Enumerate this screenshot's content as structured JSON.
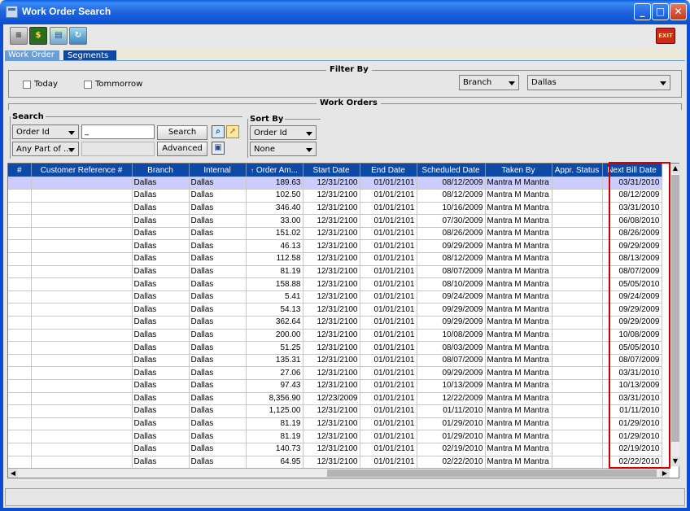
{
  "window": {
    "title": "Work Order Search",
    "buttons": {
      "minimize": "_",
      "maximize": "□",
      "close": "✕"
    }
  },
  "toolbar": {
    "icons": [
      "scanner-icon",
      "pay-icon",
      "report-icon",
      "refresh-icon"
    ],
    "pay_label": "$",
    "exit_label": "EXIT"
  },
  "tabs": [
    {
      "label": "Work Order",
      "active": false
    },
    {
      "label": "Segments",
      "active": true
    }
  ],
  "filter": {
    "legend": "Filter By",
    "today_label": "Today",
    "tomorrow_label": "Tommorrow",
    "field_value": "Branch",
    "city_value": "Dallas"
  },
  "orders": {
    "legend": "Work Orders"
  },
  "search": {
    "legend": "Search",
    "field_value": "Order Id",
    "match_value": "Any Part of ...",
    "input_value": "_",
    "search_button": "Search",
    "advanced_button": "Advanced"
  },
  "sort": {
    "legend": "Sort By",
    "primary_value": "Order Id",
    "secondary_value": "None"
  },
  "table": {
    "columns": [
      "#",
      "Customer Reference #",
      "Branch",
      "Internal",
      "Order Am...",
      "Start Date",
      "End Date",
      "Scheduled Date",
      "Taken By",
      "Appr. Status",
      "Next Bill Date"
    ],
    "sorted_column_marker": "↑",
    "rows": [
      [
        "",
        "",
        "Dallas",
        "Dallas",
        "189.63",
        "12/31/2100",
        "01/01/2101",
        "08/12/2009",
        "Mantra M Mantra",
        "",
        "03/31/2010"
      ],
      [
        "",
        "",
        "Dallas",
        "Dallas",
        "102.50",
        "12/31/2100",
        "01/01/2101",
        "08/12/2009",
        "Mantra M Mantra",
        "",
        "08/12/2009"
      ],
      [
        "",
        "",
        "Dallas",
        "Dallas",
        "346.40",
        "12/31/2100",
        "01/01/2101",
        "10/16/2009",
        "Mantra M Mantra",
        "",
        "03/31/2010"
      ],
      [
        "",
        "",
        "Dallas",
        "Dallas",
        "33.00",
        "12/31/2100",
        "01/01/2101",
        "07/30/2009",
        "Mantra M Mantra",
        "",
        "06/08/2010"
      ],
      [
        "",
        "",
        "Dallas",
        "Dallas",
        "151.02",
        "12/31/2100",
        "01/01/2101",
        "08/26/2009",
        "Mantra M Mantra",
        "",
        "08/26/2009"
      ],
      [
        "",
        "",
        "Dallas",
        "Dallas",
        "46.13",
        "12/31/2100",
        "01/01/2101",
        "09/29/2009",
        "Mantra M Mantra",
        "",
        "09/29/2009"
      ],
      [
        "",
        "",
        "Dallas",
        "Dallas",
        "112.58",
        "12/31/2100",
        "01/01/2101",
        "08/12/2009",
        "Mantra M Mantra",
        "",
        "08/13/2009"
      ],
      [
        "",
        "",
        "Dallas",
        "Dallas",
        "81.19",
        "12/31/2100",
        "01/01/2101",
        "08/07/2009",
        "Mantra M Mantra",
        "",
        "08/07/2009"
      ],
      [
        "",
        "",
        "Dallas",
        "Dallas",
        "158.88",
        "12/31/2100",
        "01/01/2101",
        "08/10/2009",
        "Mantra M Mantra",
        "",
        "05/05/2010"
      ],
      [
        "",
        "",
        "Dallas",
        "Dallas",
        "5.41",
        "12/31/2100",
        "01/01/2101",
        "09/24/2009",
        "Mantra M Mantra",
        "",
        "09/24/2009"
      ],
      [
        "",
        "",
        "Dallas",
        "Dallas",
        "54.13",
        "12/31/2100",
        "01/01/2101",
        "09/29/2009",
        "Mantra M Mantra",
        "",
        "09/29/2009"
      ],
      [
        "",
        "",
        "Dallas",
        "Dallas",
        "362.64",
        "12/31/2100",
        "01/01/2101",
        "09/29/2009",
        "Mantra M Mantra",
        "",
        "09/29/2009"
      ],
      [
        "",
        "",
        "Dallas",
        "Dallas",
        "200.00",
        "12/31/2100",
        "01/01/2101",
        "10/08/2009",
        "Mantra M Mantra",
        "",
        "10/08/2009"
      ],
      [
        "",
        "",
        "Dallas",
        "Dallas",
        "51.25",
        "12/31/2100",
        "01/01/2101",
        "08/03/2009",
        "Mantra M Mantra",
        "",
        "05/05/2010"
      ],
      [
        "",
        "",
        "Dallas",
        "Dallas",
        "135.31",
        "12/31/2100",
        "01/01/2101",
        "08/07/2009",
        "Mantra M Mantra",
        "",
        "08/07/2009"
      ],
      [
        "",
        "",
        "Dallas",
        "Dallas",
        "27.06",
        "12/31/2100",
        "01/01/2101",
        "09/29/2009",
        "Mantra M Mantra",
        "",
        "03/31/2010"
      ],
      [
        "",
        "",
        "Dallas",
        "Dallas",
        "97.43",
        "12/31/2100",
        "01/01/2101",
        "10/13/2009",
        "Mantra M Mantra",
        "",
        "10/13/2009"
      ],
      [
        "",
        "",
        "Dallas",
        "Dallas",
        "8,356.90",
        "12/23/2009",
        "01/01/2101",
        "12/22/2009",
        "Mantra M Mantra",
        "",
        "03/31/2010"
      ],
      [
        "",
        "",
        "Dallas",
        "Dallas",
        "1,125.00",
        "12/31/2100",
        "01/01/2101",
        "01/11/2010",
        "Mantra M Mantra",
        "",
        "01/11/2010"
      ],
      [
        "",
        "",
        "Dallas",
        "Dallas",
        "81.19",
        "12/31/2100",
        "01/01/2101",
        "01/29/2010",
        "Mantra M Mantra",
        "",
        "01/29/2010"
      ],
      [
        "",
        "",
        "Dallas",
        "Dallas",
        "81.19",
        "12/31/2100",
        "01/01/2101",
        "01/29/2010",
        "Mantra M Mantra",
        "",
        "01/29/2010"
      ],
      [
        "",
        "",
        "Dallas",
        "Dallas",
        "140.73",
        "12/31/2100",
        "01/01/2101",
        "02/19/2010",
        "Mantra M Mantra",
        "",
        "02/19/2010"
      ],
      [
        "",
        "",
        "Dallas",
        "Dallas",
        "64.95",
        "12/31/2100",
        "01/01/2101",
        "02/22/2010",
        "Mantra M Mantra",
        "",
        "02/22/2010"
      ]
    ],
    "selected_row": 0
  },
  "colors": {
    "title_bar": "#1f63dd",
    "header_bg": "#0d4aa8",
    "selected_row": "#ccccff",
    "highlight": "#d00000"
  }
}
